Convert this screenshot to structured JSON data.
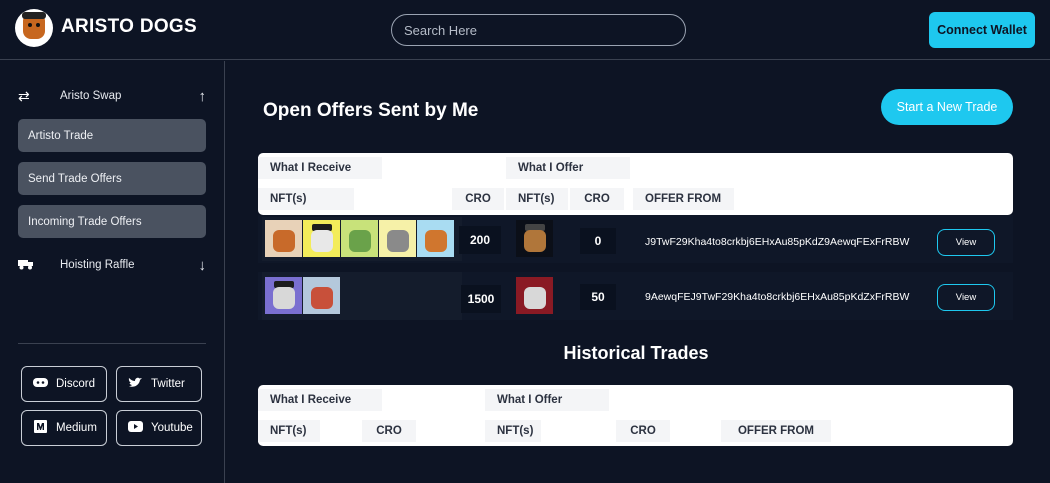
{
  "header": {
    "brand": "ARISTO DOGS",
    "search_placeholder": "Search Here",
    "connect_label": "Connect Wallet"
  },
  "sidebar": {
    "swap_label": "Aristo Swap",
    "items": [
      "Artisto Trade",
      "Send Trade Offers",
      "Incoming Trade Offers"
    ],
    "raffle_label": "Hoisting Raffle",
    "social": [
      "Discord",
      "Twitter",
      "Medium",
      "Youtube"
    ]
  },
  "main": {
    "title": "Open Offers Sent by Me",
    "new_trade_label": "Start a New Trade",
    "columns": {
      "receive": "What I Receive",
      "offer": "What I Offer",
      "nfts": "NFT(s)",
      "cro": "CRO",
      "offer_from": "OFFER FROM"
    },
    "offers": [
      {
        "receive_cro": "200",
        "offer_cro": "0",
        "address": "J9TwF29Kha4to8crkbj6EHxAu85pKdZ9AewqFExFrRBW",
        "view_label": "View"
      },
      {
        "receive_cro": "1500",
        "offer_cro": "50",
        "address": "9AewqFEJ9TwF29Kha4to8crkbj6EHxAu85pKdZxFrRBW",
        "view_label": "View"
      }
    ],
    "history_title": "Historical Trades",
    "history_columns": {
      "receive": "What I Receive",
      "offer": "What I Offer",
      "nfts_a": "NFT(s)",
      "cro_a": "CRO",
      "nfts_b": "NFT(s)",
      "cro_b": "CRO",
      "offer_from": "OFFER FROM"
    }
  },
  "colors": {
    "background": "#0d1424",
    "accent": "#1ec8ef",
    "sidebar_button": "#4a5260"
  }
}
